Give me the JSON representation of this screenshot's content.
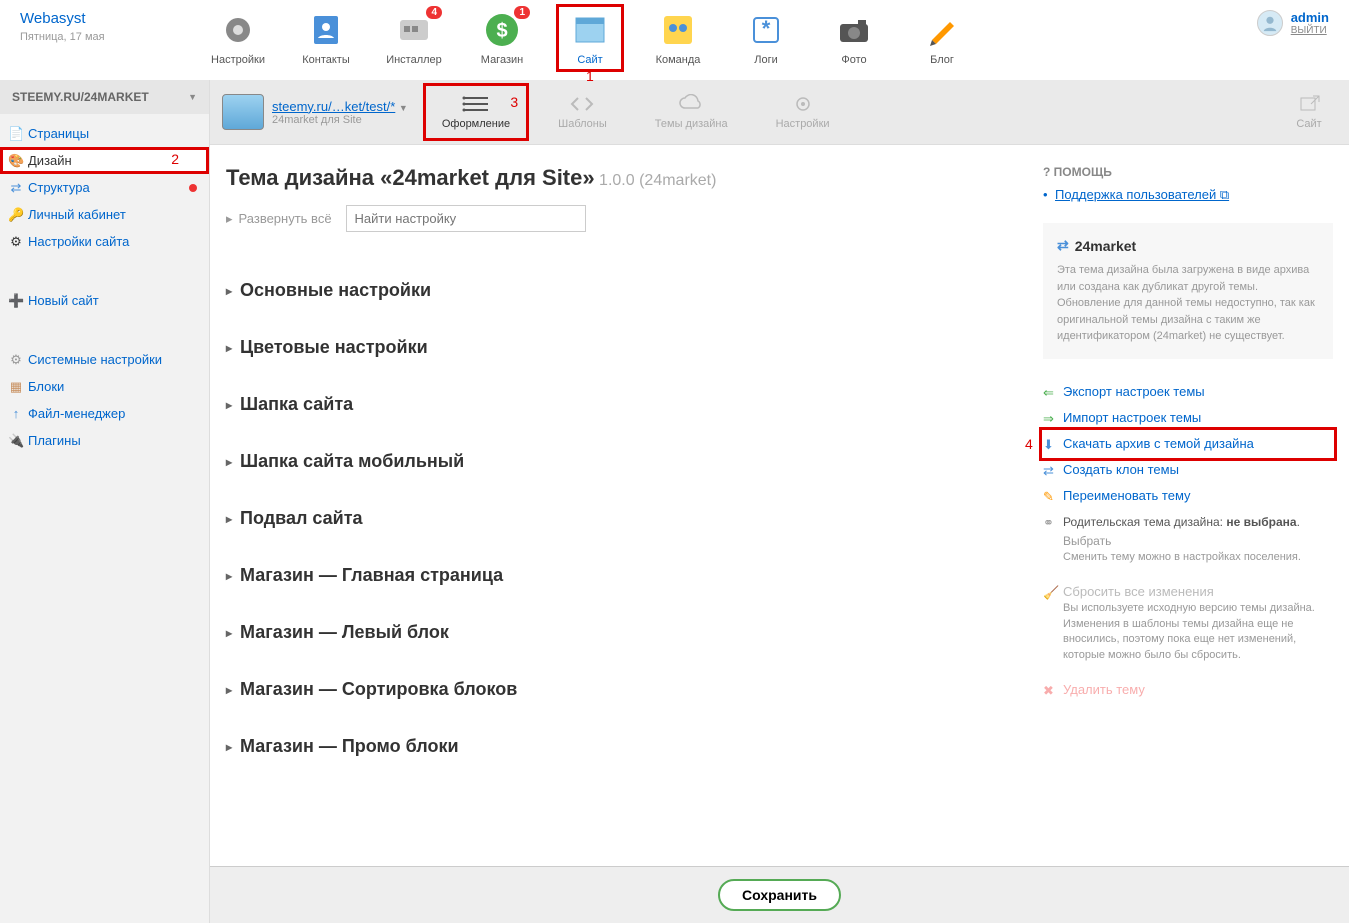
{
  "brand": {
    "name": "Webasyst",
    "date": "Пятница, 17 мая"
  },
  "user": {
    "name": "admin",
    "logout": "ВЫЙТИ"
  },
  "apps": [
    {
      "label": "Настройки",
      "badge": null
    },
    {
      "label": "Контакты",
      "badge": null
    },
    {
      "label": "Инсталлер",
      "badge": "4"
    },
    {
      "label": "Магазин",
      "badge": "1"
    },
    {
      "label": "Сайт",
      "badge": null,
      "selected": true,
      "mark": "1"
    },
    {
      "label": "Команда",
      "badge": null
    },
    {
      "label": "Логи",
      "badge": null
    },
    {
      "label": "Фото",
      "badge": null
    },
    {
      "label": "Блог",
      "badge": null
    }
  ],
  "sidebar": {
    "title": "STEEMY.RU/24MARKET",
    "nav1": [
      {
        "label": "Страницы",
        "icon": "📄"
      },
      {
        "label": "Дизайн",
        "icon": "🎨",
        "active": true,
        "mark": "2"
      },
      {
        "label": "Структура",
        "icon": "🔀",
        "badge": true
      },
      {
        "label": "Личный кабинет",
        "icon": "🔑"
      },
      {
        "label": "Настройки сайта",
        "icon": "⚙"
      }
    ],
    "new_site": "Новый сайт",
    "nav2": [
      {
        "label": "Системные настройки",
        "icon": "⚙"
      },
      {
        "label": "Блоки",
        "icon": "▦"
      },
      {
        "label": "Файл-менеджер",
        "icon": "↑"
      },
      {
        "label": "Плагины",
        "icon": "🔌"
      }
    ]
  },
  "toolbar": {
    "breadcrumb": "steemy.ru/…ket/test/*",
    "breadcrumb_sub": "24market для Site",
    "items": [
      {
        "label": "Оформление",
        "active": true,
        "mark": "3"
      },
      {
        "label": "Шаблоны"
      },
      {
        "label": "Темы дизайна"
      },
      {
        "label": "Настройки"
      }
    ],
    "site_link": "Сайт"
  },
  "page": {
    "title_prefix": "Тема дизайна «24market для Site»",
    "version": " 1.0.0 (24market)",
    "expand_all": "Развернуть всё",
    "search_placeholder": "Найти настройку"
  },
  "sections": [
    "Основные настройки",
    "Цветовые настройки",
    "Шапка сайта",
    "Шапка сайта мобильный",
    "Подвал сайта",
    "Магазин — Главная страница",
    "Магазин — Левый блок",
    "Магазин — Сортировка блоков",
    "Магазин — Промо блоки"
  ],
  "help": {
    "header": "ПОМОЩЬ",
    "link": "Поддержка пользователей ⧉"
  },
  "info_box": {
    "name": "24market",
    "desc": "Эта тема дизайна была загружена в виде архива или создана как дубликат другой темы. Обновление для данной темы недоступно, так как оригинальной темы дизайна с таким же идентификатором (24market) не существует."
  },
  "actions": {
    "export": "Экспорт настроек темы",
    "import": "Импорт настроек темы",
    "download": "Скачать архив с темой дизайна",
    "download_mark": "4",
    "clone": "Создать клон темы",
    "rename": "Переименовать тему",
    "parent_label": "Родительская тема дизайна:",
    "parent_none": "не выбрана",
    "parent_choose": "Выбрать",
    "parent_hint": "Сменить тему можно в настройках поселения.",
    "reset": "Сбросить все изменения",
    "reset_hint": "Вы используете исходную версию темы дизайна. Изменения в шаблоны темы дизайна еще не вносились, поэтому пока еще нет изменений, которые можно было бы сбросить.",
    "delete": "Удалить тему"
  },
  "save_label": "Сохранить"
}
